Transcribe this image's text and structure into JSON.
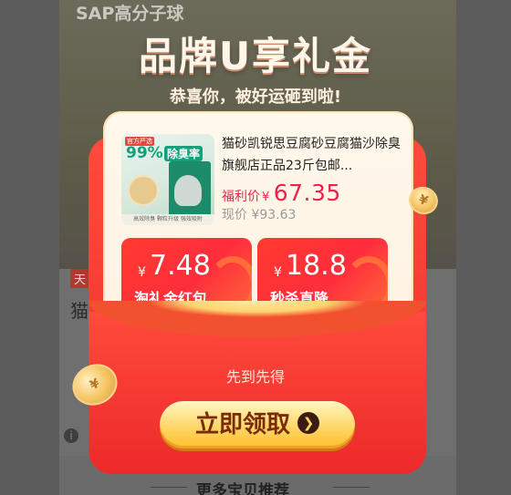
{
  "background": {
    "brand": "SAP高分子球",
    "badge": "天",
    "category_char": "猫",
    "section_title": "更多宝贝推荐",
    "info_icon": "info-icon"
  },
  "popup": {
    "headline": "品牌U享礼金",
    "subline": "恭喜你，被好运砸到啦!",
    "product": {
      "image_tag": "官方严选",
      "image_pct": "99%",
      "image_removal": "除臭率",
      "image_footer": "高效除臭  颗粒升级  强效吸附",
      "title": "猫砂凯锐思豆腐砂豆腐猫沙除臭旗舰店正品23斤包邮...",
      "welfare_label": "福利价",
      "welfare_currency": "¥",
      "welfare_price": "67.35",
      "current_label": "现价",
      "current_price": "¥93.63"
    },
    "coupons": [
      {
        "currency": "¥",
        "amount": "7.48",
        "label": "淘礼金红包"
      },
      {
        "currency": "¥",
        "amount": "18.8",
        "label": "秒杀直降"
      }
    ],
    "first_come": "先到先得",
    "claim_label": "立即领取",
    "claim_icon": "arrow-right-circle-icon",
    "colors": {
      "primary_red": "#f0302b",
      "price_red": "#e8244a",
      "gold": "#ffd460"
    }
  }
}
